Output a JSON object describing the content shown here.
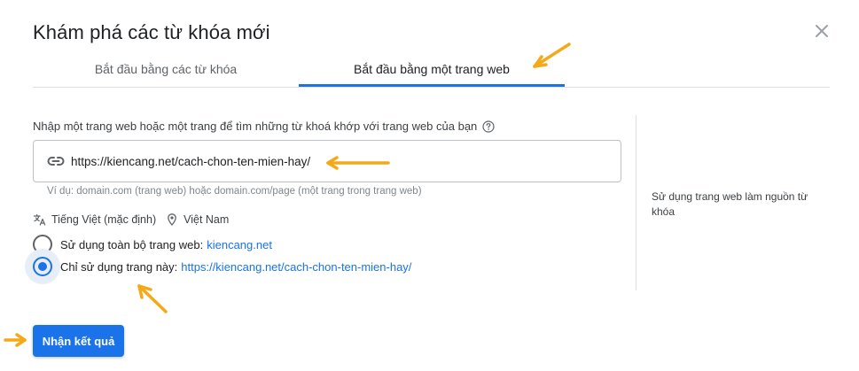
{
  "dialog": {
    "title": "Khám phá các từ khóa mới",
    "close_icon": "close-icon"
  },
  "tabs": [
    {
      "label": "Bắt đầu bằng các từ khóa",
      "selected": false
    },
    {
      "label": "Bắt đầu bằng một trang web",
      "selected": true
    }
  ],
  "url_section": {
    "label": "Nhập một trang web hoặc một trang để tìm những từ khoá khớp với trang web của bạn",
    "help_icon": "help-circle-icon",
    "link_icon": "link-icon",
    "value": "https://kiencang.net/cach-chon-ten-mien-hay/",
    "hint": "Ví dụ: domain.com (trang web) hoặc domain.com/page (một trang trong trang web)"
  },
  "locale": {
    "language_icon": "translate-icon",
    "language": "Tiếng Việt (mặc định)",
    "location_icon": "location-pin-icon",
    "location": "Việt Nam"
  },
  "scope_options": [
    {
      "label": "Sử dụng toàn bộ trang web:",
      "link": "kiencang.net",
      "selected": false
    },
    {
      "label": "Chỉ sử dụng trang này:",
      "link": "https://kiencang.net/cach-chon-ten-mien-hay/",
      "selected": true
    }
  ],
  "side_note": "Sử dụng trang web làm nguồn từ khóa",
  "submit_label": "Nhận kết quả",
  "colors": {
    "accent": "#1a73e8",
    "annotation_arrow": "#f4a919"
  }
}
